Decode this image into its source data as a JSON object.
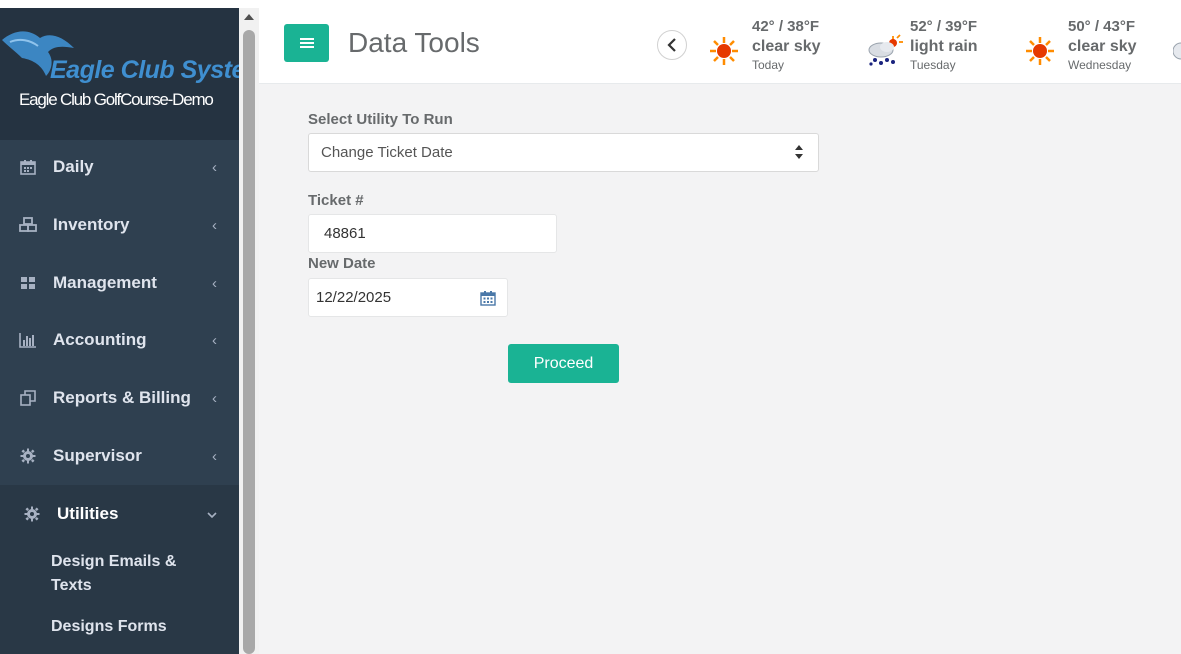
{
  "brand": {
    "logo_text": "Eagle Club Systems",
    "club_name": "Eagle Club GolfCourse-Demo"
  },
  "sidebar": {
    "items": [
      {
        "label": "Daily",
        "icon": "calendar-icon"
      },
      {
        "label": "Inventory",
        "icon": "cubes-icon"
      },
      {
        "label": "Management",
        "icon": "grid-icon"
      },
      {
        "label": "Accounting",
        "icon": "bar-chart-icon"
      },
      {
        "label": "Reports & Billing",
        "icon": "copy-icon"
      },
      {
        "label": "Supervisor",
        "icon": "gear-icon"
      },
      {
        "label": "Utilities",
        "icon": "gear-icon",
        "expanded": true
      }
    ],
    "subitems": [
      {
        "label": "Design Emails & Texts"
      },
      {
        "label": "Designs Forms"
      }
    ]
  },
  "header": {
    "title": "Data Tools"
  },
  "weather": [
    {
      "temp": "42° / 38°F",
      "desc": "clear sky",
      "day": "Today",
      "icon": "sun-icon"
    },
    {
      "temp": "52° / 39°F",
      "desc": "light rain",
      "day": "Tuesday",
      "icon": "rain-cloud-icon"
    },
    {
      "temp": "50° / 43°F",
      "desc": "clear sky",
      "day": "Wednesday",
      "icon": "sun-icon"
    }
  ],
  "form": {
    "utility_label": "Select Utility To Run",
    "utility_value": "Change Ticket Date",
    "ticket_label": "Ticket #",
    "ticket_value": "48861",
    "date_label": "New Date",
    "date_value": "12/22/2025",
    "proceed_label": "Proceed"
  },
  "colors": {
    "accent": "#1ab394",
    "sidebar_bg": "#2f4050",
    "sidebar_top": "#253341",
    "sidebar_active": "#293846",
    "logo_blue": "#3f8fd0"
  }
}
